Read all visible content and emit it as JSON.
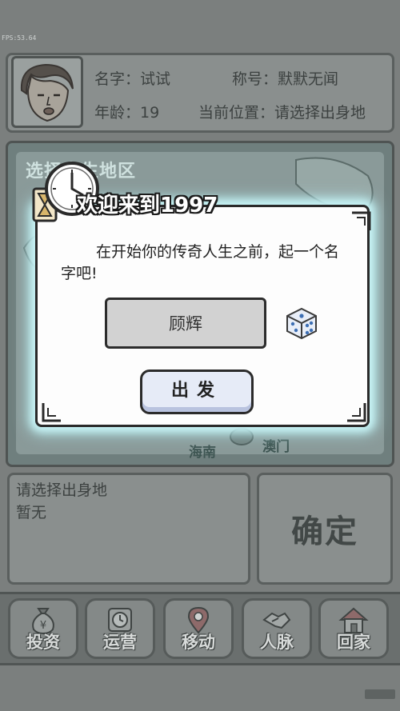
{
  "fps": "FPS:53.64",
  "profile": {
    "name_label": "名字：试试",
    "title_label": "称号：默默无闻",
    "age_label": "年龄：19",
    "location_label": "当前位置：请选择出身地"
  },
  "map": {
    "title": "选择出生地区",
    "regions": [
      "海南",
      "澳门"
    ]
  },
  "info": {
    "heading": "请选择出身地",
    "value": "暂无"
  },
  "confirm_label": "确定",
  "toolbar": [
    {
      "label": "投资",
      "icon": "money-bag-icon"
    },
    {
      "label": "运营",
      "icon": "clock-icon"
    },
    {
      "label": "移动",
      "icon": "map-pin-icon"
    },
    {
      "label": "人脉",
      "icon": "handshake-icon"
    },
    {
      "label": "回家",
      "icon": "house-icon"
    }
  ],
  "dialog": {
    "title": "欢迎来到1997",
    "message": "在开始你的传奇人生之前，起一个名字吧!",
    "name_value": "顾辉",
    "go_label": "出发"
  },
  "colors": {
    "dim_overlay": "#7b7f7e",
    "dialog_glow": "#c9f5f7",
    "go_button": "#e6ebf7"
  }
}
